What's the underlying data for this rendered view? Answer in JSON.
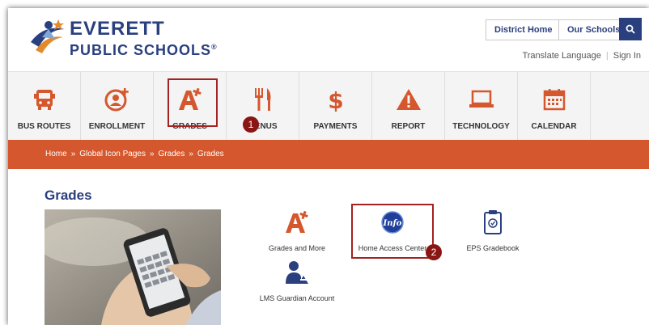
{
  "header": {
    "logo_line1": "EVERETT",
    "logo_line2": "PUBLIC SCHOOLS",
    "logo_reg": "®",
    "district_home": "District Home",
    "our_schools": "Our Schools",
    "translate": "Translate Language",
    "sign_in": "Sign In",
    "separator": "|"
  },
  "nav": {
    "items": [
      {
        "label": "BUS ROUTES",
        "icon": "bus-icon"
      },
      {
        "label": "ENROLLMENT",
        "icon": "add-person-icon"
      },
      {
        "label": "GRADES",
        "icon": "grade-a-plus-icon"
      },
      {
        "label": "MENUS",
        "icon": "fork-knife-icon"
      },
      {
        "label": "PAYMENTS",
        "icon": "dollar-icon"
      },
      {
        "label": "REPORT",
        "icon": "warning-icon"
      },
      {
        "label": "TECHNOLOGY",
        "icon": "laptop-icon"
      },
      {
        "label": "CALENDAR",
        "icon": "calendar-icon"
      }
    ]
  },
  "breadcrumb": {
    "items": [
      "Home",
      "Global Icon Pages",
      "Grades",
      "Grades"
    ],
    "separator": "»"
  },
  "main": {
    "title": "Grades",
    "tiles": [
      {
        "label": "Grades and More",
        "icon": "grade-a-plus-icon"
      },
      {
        "label": "Home Access Center",
        "icon": "info-badge-icon",
        "icon_text": "Info"
      },
      {
        "label": "EPS Gradebook",
        "icon": "clipboard-icon"
      },
      {
        "label": "LMS Guardian Account",
        "icon": "guardian-icon"
      }
    ]
  },
  "annotations": {
    "step1": "1",
    "step2": "2"
  },
  "colors": {
    "navy": "#2a3f7e",
    "orange": "#d5572d",
    "highlight": "#a42222"
  }
}
